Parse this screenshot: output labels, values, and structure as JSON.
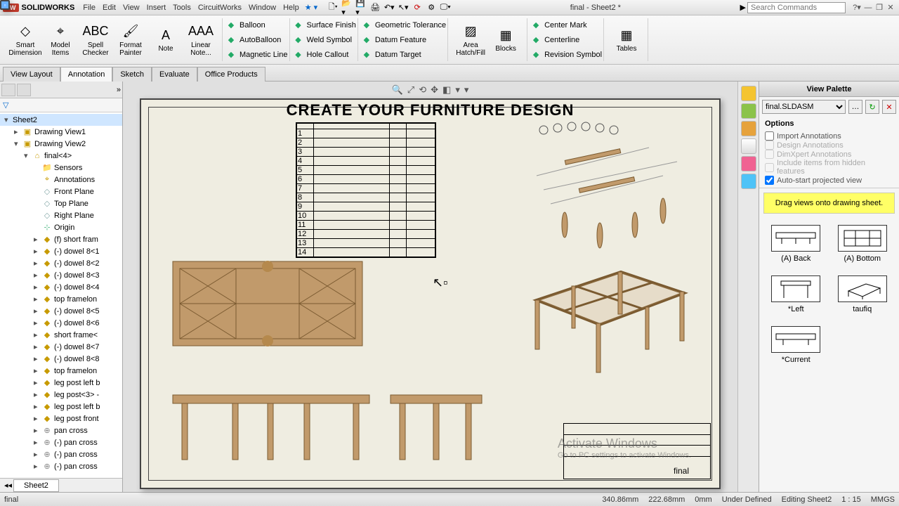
{
  "app": {
    "name": "SOLIDWORKS",
    "doc_title": "final - Sheet2 *"
  },
  "menu": [
    "File",
    "Edit",
    "View",
    "Insert",
    "Tools",
    "CircuitWorks",
    "Window",
    "Help"
  ],
  "search_placeholder": "Search Commands",
  "ribbon": {
    "big": [
      {
        "label": "Smart\nDimension",
        "glyph": "◇"
      },
      {
        "label": "Model\nItems",
        "glyph": "⌖"
      },
      {
        "label": "Spell\nChecker",
        "glyph": "ABC"
      },
      {
        "label": "Format\nPainter",
        "glyph": "🖌"
      },
      {
        "label": "Note",
        "glyph": "A"
      },
      {
        "label": "Linear\nNote...",
        "glyph": "AAA"
      }
    ],
    "col1": [
      "Balloon",
      "AutoBalloon",
      "Magnetic Line"
    ],
    "col2": [
      "Surface Finish",
      "Weld Symbol",
      "Hole Callout"
    ],
    "col3": [
      "Geometric Tolerance",
      "Datum Feature",
      "Datum Target"
    ],
    "big2": [
      {
        "label": "Area\nHatch/Fill",
        "glyph": "▨"
      },
      {
        "label": "Blocks",
        "glyph": "▦"
      }
    ],
    "col4": [
      "Center Mark",
      "Centerline",
      "Revision Symbol"
    ],
    "big3": [
      {
        "label": "Tables",
        "glyph": "▦"
      }
    ]
  },
  "tabs": [
    "View Layout",
    "Annotation",
    "Sketch",
    "Evaluate",
    "Office Products"
  ],
  "active_tab": "Annotation",
  "tree": [
    {
      "d": 0,
      "t": "Sheet2",
      "ico": "sheet",
      "sel": true,
      "tw": "▾"
    },
    {
      "d": 1,
      "t": "Drawing View1",
      "ico": "view",
      "tw": "▸"
    },
    {
      "d": 1,
      "t": "Drawing View2",
      "ico": "view",
      "tw": "▾"
    },
    {
      "d": 2,
      "t": "final<4>",
      "ico": "asm",
      "tw": "▾"
    },
    {
      "d": 3,
      "t": "Sensors",
      "ico": "folder"
    },
    {
      "d": 3,
      "t": "Annotations",
      "ico": "ann"
    },
    {
      "d": 3,
      "t": "Front Plane",
      "ico": "plane"
    },
    {
      "d": 3,
      "t": "Top Plane",
      "ico": "plane"
    },
    {
      "d": 3,
      "t": "Right Plane",
      "ico": "plane"
    },
    {
      "d": 3,
      "t": "Origin",
      "ico": "origin"
    },
    {
      "d": 3,
      "t": "(f) short fram",
      "ico": "part",
      "tw": "▸"
    },
    {
      "d": 3,
      "t": "(-) dowel 8<1",
      "ico": "part",
      "tw": "▸"
    },
    {
      "d": 3,
      "t": "(-) dowel 8<2",
      "ico": "part",
      "tw": "▸"
    },
    {
      "d": 3,
      "t": "(-) dowel 8<3",
      "ico": "part",
      "tw": "▸"
    },
    {
      "d": 3,
      "t": "(-) dowel 8<4",
      "ico": "part",
      "tw": "▸"
    },
    {
      "d": 3,
      "t": "top framelon",
      "ico": "part",
      "tw": "▸"
    },
    {
      "d": 3,
      "t": "(-) dowel 8<5",
      "ico": "part",
      "tw": "▸"
    },
    {
      "d": 3,
      "t": "(-) dowel 8<6",
      "ico": "part",
      "tw": "▸"
    },
    {
      "d": 3,
      "t": "short frame<",
      "ico": "part",
      "tw": "▸"
    },
    {
      "d": 3,
      "t": "(-) dowel 8<7",
      "ico": "part",
      "tw": "▸"
    },
    {
      "d": 3,
      "t": "(-) dowel 8<8",
      "ico": "part",
      "tw": "▸"
    },
    {
      "d": 3,
      "t": "top framelon",
      "ico": "part",
      "tw": "▸"
    },
    {
      "d": 3,
      "t": "leg post left b",
      "ico": "part",
      "tw": "▸"
    },
    {
      "d": 3,
      "t": "leg post<3> -",
      "ico": "part",
      "tw": "▸"
    },
    {
      "d": 3,
      "t": "leg post left b",
      "ico": "part",
      "tw": "▸"
    },
    {
      "d": 3,
      "t": "leg post front",
      "ico": "part",
      "tw": "▸"
    },
    {
      "d": 3,
      "t": "pan cross",
      "ico": "fast",
      "tw": "▸"
    },
    {
      "d": 3,
      "t": "(-) pan cross",
      "ico": "fast",
      "tw": "▸"
    },
    {
      "d": 3,
      "t": "(-) pan cross",
      "ico": "fast",
      "tw": "▸"
    },
    {
      "d": 3,
      "t": "(-) pan cross",
      "ico": "fast",
      "tw": "▸"
    }
  ],
  "sheet_tab": "Sheet2",
  "drawing_title": "CREATE YOUR FURNITURE DESIGN",
  "title_block_label": "final",
  "palette": {
    "title": "View Palette",
    "file": "final.SLDASM",
    "options_label": "Options",
    "opts": [
      {
        "label": "Import Annotations",
        "checked": false,
        "dis": false
      },
      {
        "label": "Design Annotations",
        "checked": false,
        "dis": true
      },
      {
        "label": "DimXpert Annotations",
        "checked": false,
        "dis": true
      },
      {
        "label": "Include items from hidden features",
        "checked": false,
        "dis": true
      },
      {
        "label": "Auto-start projected view",
        "checked": true,
        "dis": false
      }
    ],
    "hint": "Drag views onto drawing sheet.",
    "views": [
      "(A) Back",
      "(A) Bottom",
      "*Left",
      "taufiq",
      "*Current"
    ]
  },
  "status": {
    "left": "final",
    "coords": [
      "340.86mm",
      "222.68mm",
      "0mm"
    ],
    "state": "Under Defined",
    "editing": "Editing Sheet2",
    "scale": "1 : 15",
    "units": "MMGS"
  },
  "activate": {
    "l1": "Activate Windows",
    "l2": "Go to PC settings to activate Windows."
  }
}
